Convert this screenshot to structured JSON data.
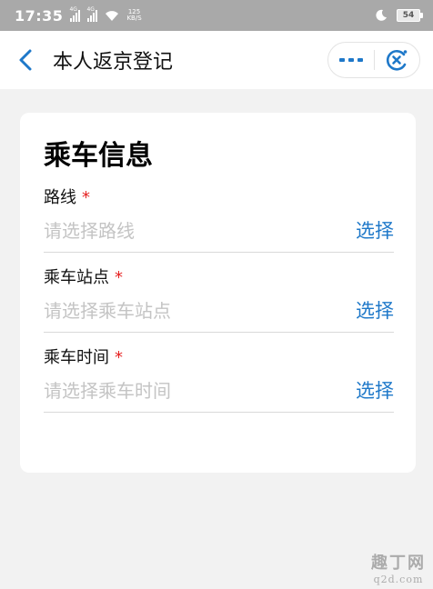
{
  "status_bar": {
    "time": "17:35",
    "signal1_label": "4G",
    "signal2_label": "4G",
    "net_speed_value": "125",
    "net_speed_unit": "KB/S",
    "battery": "54"
  },
  "nav": {
    "title": "本人返京登记",
    "more_icon": "more-dots-icon",
    "close_icon": "close-target-icon"
  },
  "form": {
    "section_title": "乘车信息",
    "required_mark": "*",
    "fields": [
      {
        "label": "路线",
        "placeholder": "请选择路线",
        "action": "选择"
      },
      {
        "label": "乘车站点",
        "placeholder": "请选择乘车站点",
        "action": "选择"
      },
      {
        "label": "乘车时间",
        "placeholder": "请选择乘车时间",
        "action": "选择"
      }
    ]
  },
  "watermark": {
    "top": "趣丁网",
    "bottom": "q2d.com"
  },
  "colors": {
    "accent": "#1e78c9",
    "required": "#e52222",
    "placeholder": "#c4c4c4",
    "status_bar": "#a9a9a9"
  }
}
